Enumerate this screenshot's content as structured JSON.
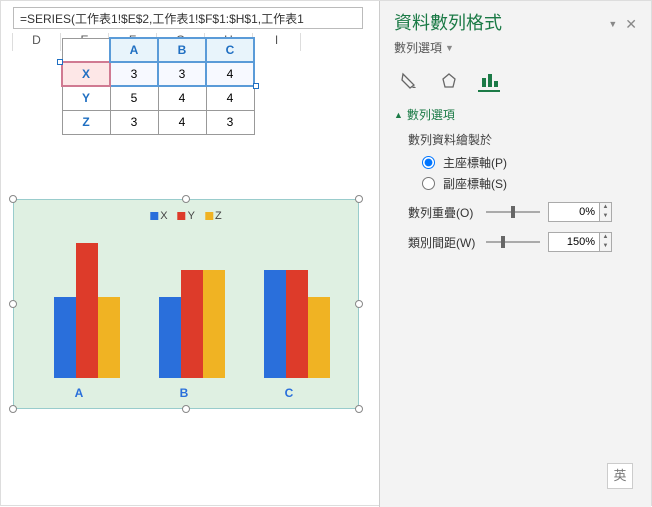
{
  "formula_bar": "=SERIES(工作表1!$E$2,工作表1!$F$1:$H$1,工作表1",
  "columns": [
    "D",
    "E",
    "F",
    "G",
    "H",
    "I"
  ],
  "table": {
    "col_labels": [
      "A",
      "B",
      "C"
    ],
    "rows": [
      {
        "label": "X",
        "vals": [
          "3",
          "3",
          "4"
        ]
      },
      {
        "label": "Y",
        "vals": [
          "5",
          "4",
          "4"
        ]
      },
      {
        "label": "Z",
        "vals": [
          "3",
          "4",
          "3"
        ]
      }
    ]
  },
  "legend": {
    "x": "X",
    "y": "Y",
    "z": "Z"
  },
  "axis_labels": [
    "A",
    "B",
    "C"
  ],
  "panel": {
    "title": "資料數列格式",
    "subtitle": "數列選項",
    "section": "數列選項",
    "plotted_on": "數列資料繪製於",
    "primary": "主座標軸(P)",
    "secondary": "副座標軸(S)",
    "overlap_lbl": "數列重疊(O)",
    "overlap_val": "0%",
    "gap_lbl": "類別間距(W)",
    "gap_val": "150%",
    "ime": "英"
  },
  "chart_data": {
    "type": "bar",
    "title": "",
    "categories": [
      "A",
      "B",
      "C"
    ],
    "series": [
      {
        "name": "X",
        "values": [
          3,
          3,
          4
        ]
      },
      {
        "name": "Y",
        "values": [
          5,
          4,
          4
        ]
      },
      {
        "name": "Z",
        "values": [
          3,
          4,
          3
        ]
      }
    ],
    "ylim": [
      0,
      5
    ],
    "legend_position": "top"
  }
}
